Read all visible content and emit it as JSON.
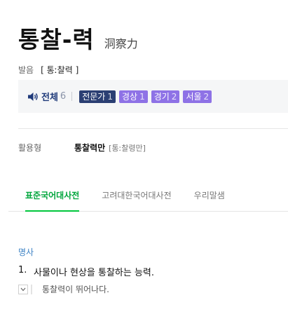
{
  "entry": {
    "headword": "통찰-력",
    "hanja": "洞察力"
  },
  "pronunciation": {
    "label": "발음",
    "value": "[ 통ː찰력 ]"
  },
  "audio": {
    "all_label": "전체",
    "all_count": "6",
    "chips": [
      {
        "label": "전문가",
        "count": "1",
        "color": "#2b3f73"
      },
      {
        "label": "경상",
        "count": "1",
        "color": "#8e72e6"
      },
      {
        "label": "경기",
        "count": "2",
        "color": "#8e72e6"
      },
      {
        "label": "서울",
        "count": "2",
        "color": "#8e72e6"
      }
    ]
  },
  "conjugation": {
    "label": "활용형",
    "form": "통찰력만",
    "pron": "[통ː찰령만]"
  },
  "tabs": [
    {
      "label": "표준국어대사전",
      "active": true
    },
    {
      "label": "고려대한국어대사전",
      "active": false
    },
    {
      "label": "우리말샘",
      "active": false
    }
  ],
  "definition": {
    "part_of_speech": "명사",
    "number": "1.",
    "text": "사물이나 현상을 통찰하는 능력.",
    "example": "통찰력이 뛰어나다."
  },
  "colors": {
    "accent_green": "#00c73c",
    "pos_blue": "#3d82c4",
    "chip_dark": "#2b3f73",
    "chip_purple": "#8e72e6"
  }
}
